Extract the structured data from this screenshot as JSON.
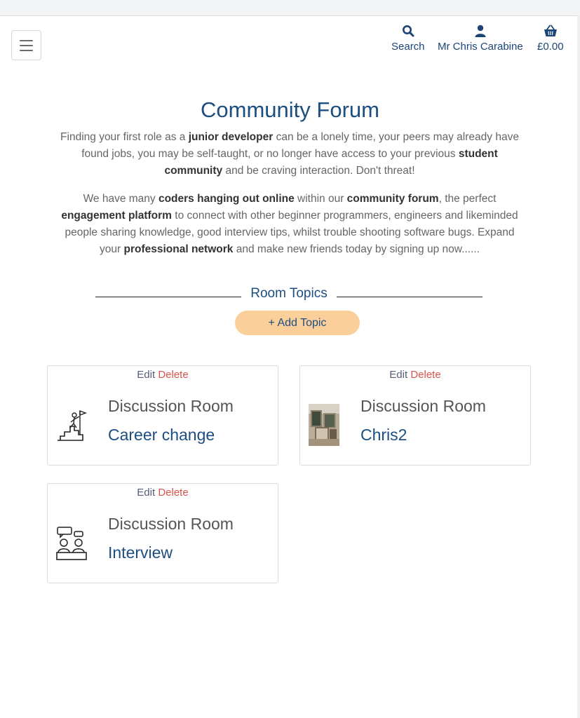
{
  "header": {
    "search_label": "Search",
    "account_label": "Mr Chris Carabine",
    "basket_label": "£0.00",
    "icons": {
      "menu": "hamburger-menu-icon",
      "search": "search-icon",
      "account": "user-icon",
      "basket": "shopping-basket-icon"
    },
    "accent_color": "#1a4576"
  },
  "main": {
    "title": "Community Forum",
    "p1": [
      {
        "t": "Finding your first role as a ",
        "b": false
      },
      {
        "t": "junior developer",
        "b": true
      },
      {
        "t": " can be a lonely time, your peers may already have found jobs, you may be self-taught, or no longer have access to your previous ",
        "b": false
      },
      {
        "t": "student community",
        "b": true
      },
      {
        "t": " and be craving interaction. Don't threat!",
        "b": false
      }
    ],
    "p2": [
      {
        "t": "We have many ",
        "b": false
      },
      {
        "t": "coders hanging out online",
        "b": true
      },
      {
        "t": " within our ",
        "b": false
      },
      {
        "t": "community forum",
        "b": true
      },
      {
        "t": ", the perfect ",
        "b": false
      },
      {
        "t": "engagement platform",
        "b": true
      },
      {
        "t": " to connect with other beginner programmers, engineers and likeminded people sharing knowledge, good interview tips, whilst trouble shooting software bugs. Expand your ",
        "b": false
      },
      {
        "t": "professional network",
        "b": true
      },
      {
        "t": " and make new friends today by signing up now......",
        "b": false
      }
    ],
    "section_heading": "Room Topics",
    "add_topic_label": "+ Add Topic",
    "add_topic_color": "#fbcf9a"
  },
  "rooms": [
    {
      "edit": "Edit",
      "delete": "Delete",
      "room_label": "Discussion Room",
      "topic": "Career change",
      "icon": "career-ladder-flag-icon"
    },
    {
      "edit": "Edit",
      "delete": "Delete",
      "room_label": "Discussion Room",
      "topic": "Chris2",
      "icon": "photo-thumbnail"
    },
    {
      "edit": "Edit",
      "delete": "Delete",
      "room_label": "Discussion Room",
      "topic": "Interview",
      "icon": "interview-people-icon"
    }
  ]
}
